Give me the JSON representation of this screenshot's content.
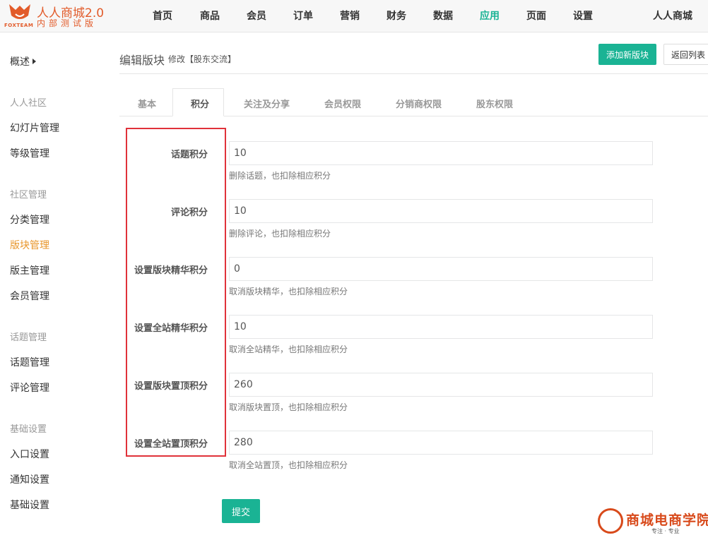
{
  "brand": {
    "logo_sub": "FOXTEAM",
    "title": "人人商城2.0",
    "subtitle": "内部测试版",
    "accent": "#e25b2a"
  },
  "topnav": {
    "items": [
      "首页",
      "商品",
      "会员",
      "订单",
      "营销",
      "财务",
      "数据",
      "应用",
      "页面",
      "设置"
    ],
    "active": "应用",
    "right": "人人商城",
    "active_color": "#1ab394"
  },
  "sidebar": {
    "overview": "概述",
    "groups": [
      {
        "title": "人人社区",
        "items": [
          "幻灯片管理",
          "等级管理"
        ]
      },
      {
        "title": "社区管理",
        "items": [
          "分类管理",
          "版块管理",
          "版主管理",
          "会员管理"
        ]
      },
      {
        "title": "话题管理",
        "items": [
          "话题管理",
          "评论管理"
        ]
      },
      {
        "title": "基础设置",
        "items": [
          "入口设置",
          "通知设置",
          "基础设置"
        ]
      }
    ],
    "active": "版块管理",
    "active_color": "#e8962b"
  },
  "header": {
    "title": "编辑版块",
    "sub": "修改【股东交流】",
    "add_button": "添加新版块",
    "back_button": "返回列表"
  },
  "tabs": {
    "items": [
      "基本",
      "积分",
      "关注及分享",
      "会员权限",
      "分销商权限",
      "股东权限"
    ],
    "active": "积分"
  },
  "form": {
    "fields": [
      {
        "label": "话题积分",
        "value": "10",
        "help": "删除话题，也扣除相应积分"
      },
      {
        "label": "评论积分",
        "value": "10",
        "help": "删除评论，也扣除相应积分"
      },
      {
        "label": "设置版块精华积分",
        "value": "0",
        "help": "取消版块精华，也扣除相应积分"
      },
      {
        "label": "设置全站精华积分",
        "value": "10",
        "help": "取消全站精华，也扣除相应积分"
      },
      {
        "label": "设置版块置顶积分",
        "value": "260",
        "help": "取消版块置顶，也扣除相应积分"
      },
      {
        "label": "设置全站置顶积分",
        "value": "280",
        "help": "取消全站置顶，也扣除相应积分"
      }
    ],
    "submit": "提交",
    "highlight_color": "#e0323a"
  },
  "watermark": {
    "text": "商城电商学院",
    "sub": "专注 · 专业"
  }
}
